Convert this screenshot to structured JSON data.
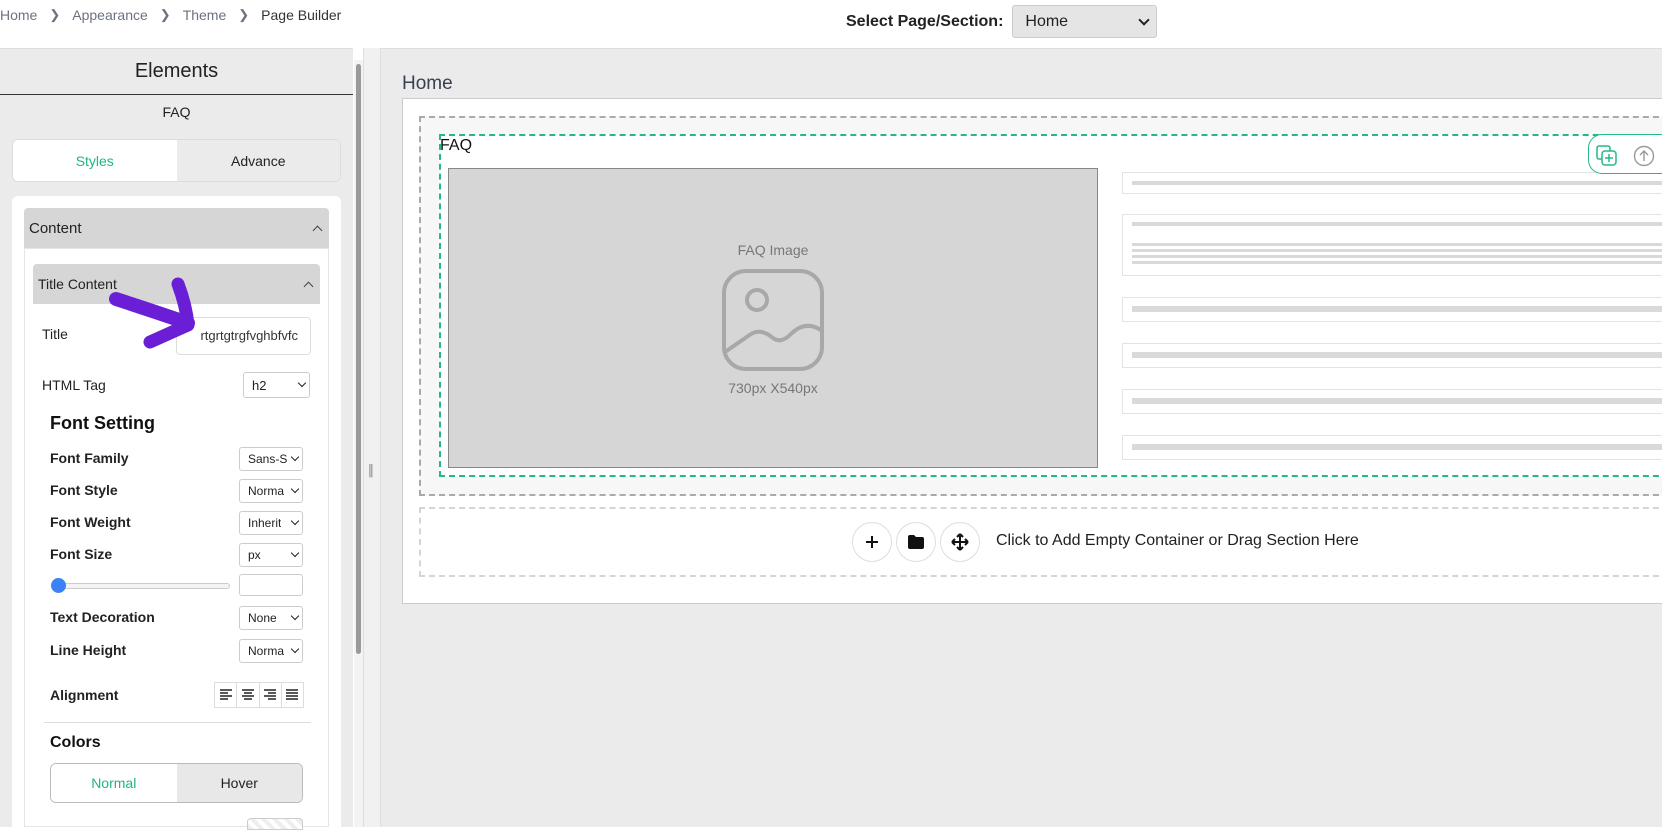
{
  "breadcrumb": {
    "items": [
      "Home",
      "Appearance",
      "Theme",
      "Page Builder"
    ]
  },
  "page_select": {
    "label": "Select Page/Section:",
    "value": "Home"
  },
  "sidebar": {
    "title": "Elements",
    "element_name": "FAQ",
    "tabs": {
      "styles": "Styles",
      "advance": "Advance"
    },
    "content_section": "Content",
    "title_content_section": "Title Content",
    "title_label": "Title",
    "title_value": "rtgrtgtrgfvghbfvfc",
    "html_tag_label": "HTML Tag",
    "html_tag_value": "h2",
    "font_setting": "Font Setting",
    "font_family_label": "Font Family",
    "font_family_value": "Sans-S",
    "font_style_label": "Font Style",
    "font_style_value": "Norma",
    "font_weight_label": "Font Weight",
    "font_weight_value": "Inherit",
    "font_size_label": "Font Size",
    "font_size_unit": "px",
    "font_size_slider": 0,
    "text_decoration_label": "Text Decoration",
    "text_decoration_value": "None",
    "line_height_label": "Line Height",
    "line_height_value": "Norma",
    "alignment_label": "Alignment",
    "colors_label": "Colors",
    "color_tabs": {
      "normal": "Normal",
      "hover": "Hover"
    }
  },
  "canvas": {
    "page_heading": "Home",
    "faq_label": "FAQ",
    "faq_image_title": "FAQ Image",
    "faq_image_dimensions": "730px X540px",
    "add_zone_text": "Click to Add Empty Container or Drag Section Here"
  },
  "colors": {
    "accent": "#1fb585",
    "dashed_selection": "#25b889",
    "annotation_arrow": "#6a1fd6",
    "slider": "#3b82f6"
  }
}
